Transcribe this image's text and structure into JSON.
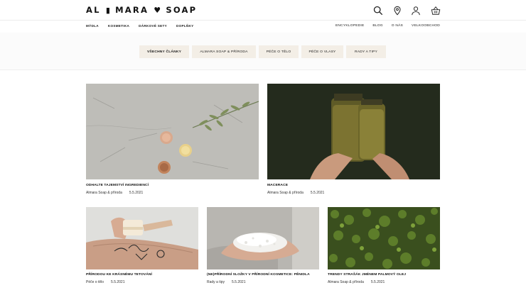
{
  "header": {
    "logo_left": "AL",
    "logo_mid": "MARA",
    "logo_right": "SOAP",
    "nav_left": [
      "MÝDLA",
      "KOSMETIKA",
      "DÁRKOVÉ SETY",
      "DOPLŇKY"
    ],
    "nav_right": [
      "ENCYKLOPEDIE",
      "BLOG",
      "O NÁS",
      "VELKOOBCHOD"
    ],
    "icons": [
      "search-icon",
      "location-pin-icon",
      "user-icon",
      "basket-icon"
    ]
  },
  "filters": {
    "items": [
      "VŠECHNY ČLÁNKY",
      "ALMARA SOAP & PŘÍRODA",
      "PÉČE O TĚLO",
      "PÉČE O VLASY",
      "RADY A TIPY"
    ],
    "active": "VŠECHNY ČLÁNKY"
  },
  "articles": [
    {
      "title": "ODHALTE TAJEMSTVÍ INGREDIENCÍ",
      "category": "Almara Soap & příroda",
      "date": "5.5.2021"
    },
    {
      "title": "MACERACE",
      "category": "Almara Soap & příroda",
      "date": "5.5.2021"
    },
    {
      "title": "PŘÍRODOU KE KRÁSNÉMU TETOVÁNÍ",
      "category": "Péče o tělo",
      "date": "5.5.2021"
    },
    {
      "title": "(NE)PŘÍRODNÍ SLOŽKY V PŘÍRODNÍ KOSMETICE: PĚNIDLA",
      "category": "Rady a tipy",
      "date": "5.5.2021"
    },
    {
      "title": "TRENDY STRAŠÁK JMÉNEM PALMOVÝ OLEJ",
      "category": "Almara Soap & příroda",
      "date": "5.5.2021"
    }
  ]
}
